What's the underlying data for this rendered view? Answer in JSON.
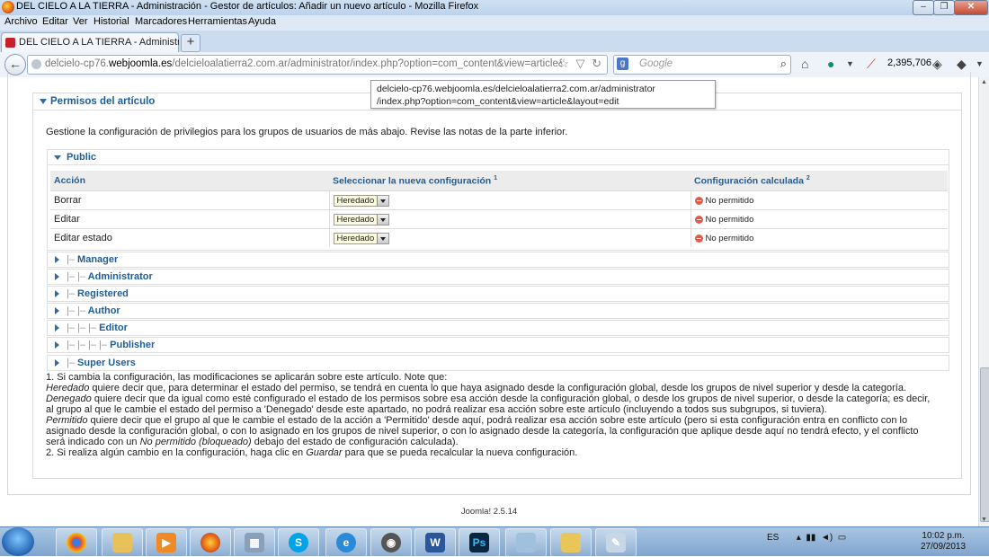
{
  "window": {
    "title": "DEL CIELO A LA TIERRA - Administración - Gestor de artículos: Añadir un nuevo artículo - Mozilla Firefox",
    "minimize": "‒",
    "maximize": "❐",
    "close": "✕"
  },
  "menu": [
    "Archivo",
    "Editar",
    "Ver",
    "Historial",
    "Marcadores",
    "Herramientas",
    "Ayuda"
  ],
  "tab": {
    "label": "DEL CIELO A LA TIERRA - Administració..."
  },
  "nav": {
    "url_prefix": "delcielo-cp76.",
    "url_domain": "webjoomla.es",
    "url_rest": "/delcieloalatierra2.com.ar/administrator/index.php?option=com_content&view=article&layout=",
    "search_placeholder": "Google",
    "counter": "2,395,706"
  },
  "tooltip": {
    "line1": "delcielo-cp76.webjoomla.es/delcieloalatierra2.com.ar/administrator",
    "line2": "/index.php?option=com_content&view=article&layout=edit"
  },
  "permissions": {
    "title": "Permisos del artículo",
    "description": "Gestione la configuración de privilegios para los grupos de usuarios de más abajo. Revise las notas de la parte inferior.",
    "public_group": "Public",
    "headers": {
      "action": "Acción",
      "new_setting": "Seleccionar la nueva configuración",
      "new_sup": "1",
      "calculated": "Configuración calculada",
      "calc_sup": "2"
    },
    "rows": [
      {
        "action": "Borrar",
        "select": "Heredado",
        "calculated": "No permitido"
      },
      {
        "action": "Editar",
        "select": "Heredado",
        "calculated": "No permitido"
      },
      {
        "action": "Editar estado",
        "select": "Heredado",
        "calculated": "No permitido"
      }
    ],
    "groups": [
      {
        "prefix": "|–",
        "name": "Manager"
      },
      {
        "prefix": "|– |–",
        "name": "Administrator"
      },
      {
        "prefix": "|–",
        "name": "Registered"
      },
      {
        "prefix": "|– |–",
        "name": "Author"
      },
      {
        "prefix": "|– |– |–",
        "name": "Editor"
      },
      {
        "prefix": "|– |– |– |–",
        "name": "Publisher"
      },
      {
        "prefix": "|–",
        "name": "Super Users"
      }
    ],
    "notes": {
      "n1": "1. Si cambia la configuración, las modificaciones se aplicarán sobre este artículo. Note que:",
      "heredado_term": "Heredado",
      "heredado_text": " quiere decir que, para determinar el estado del permiso, se tendrá en cuenta lo que haya asignado desde la configuración global, desde los grupos de nivel superior y desde la categoría.",
      "denegado_term": "Denegado",
      "denegado_text": " quiere decir que da igual como esté configurado el estado de los permisos sobre esa acción desde la configuración global, o desde los grupos de nivel superior, o desde la categoría; es decir, al grupo al que le cambie el estado del permiso a 'Denegado' desde este apartado, no podrá realizar esa acción sobre este artículo (incluyendo a todos sus subgrupos, si tuviera).",
      "permitido_term": "Permitido",
      "permitido_text": " quiere decir que el grupo al que le cambie el estado de la acción a 'Permitido' desde aquí, podrá realizar esa acción sobre este artículo (pero si esta configuración entra en conflicto con lo asignado desde la configuración global, o con lo asignado en los grupos de nivel superior, o con lo asignado desde la categoría, la configuración que aplique desde aquí no tendrá efecto, y el conflicto será indicado con un ",
      "permitido_em": "No permitido (bloqueado)",
      "permitido_tail": " debajo del estado de configuración calculada).",
      "n2_a": "2. Si realiza algún cambio en la configuración, haga clic en ",
      "n2_em": "Guardar",
      "n2_b": " para que se pueda recalcular la nueva configuración."
    }
  },
  "footer": "Joomla! 2.5.14",
  "taskbar": {
    "lang": "ES",
    "time": "10:02 p.m.",
    "date": "27/09/2013",
    "apps": [
      "chrome-icon",
      "explorer-icon",
      "media-player-icon",
      "firefox-icon",
      "calculator-icon",
      "skype-icon",
      "internet-explorer-icon",
      "webcam-icon",
      "word-icon",
      "photoshop-icon",
      "notepad-icon",
      "folder-icon",
      "paint-icon"
    ]
  },
  "colors": {
    "accent": "#1f5d99",
    "denied": "#e15b4b",
    "select_bg": "#fdfbe0"
  }
}
